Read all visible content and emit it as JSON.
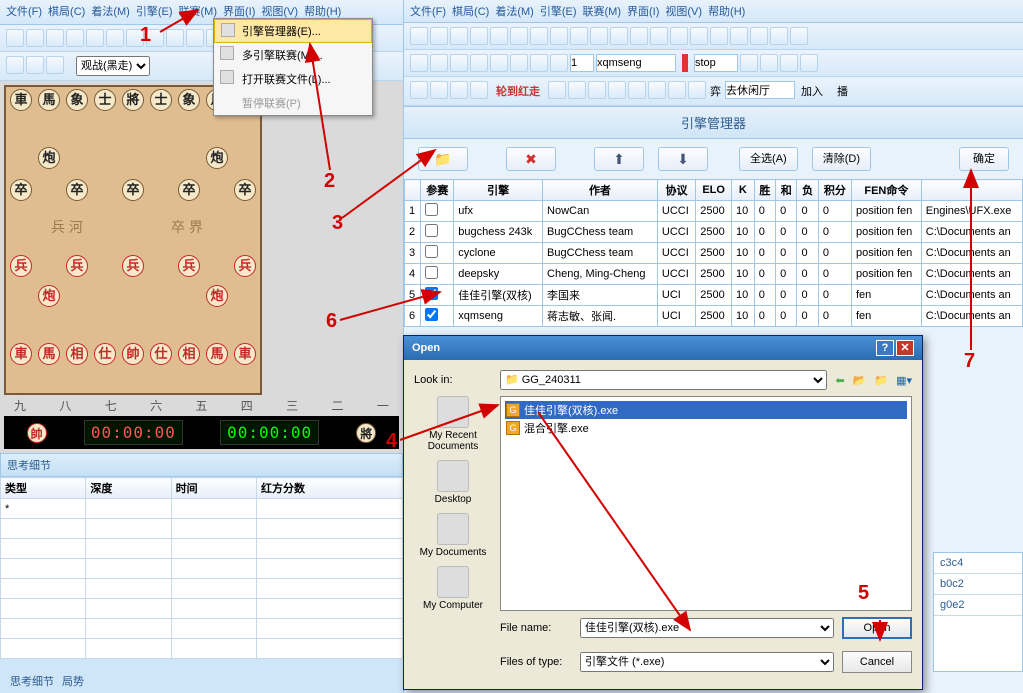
{
  "left": {
    "menus": [
      "文件(F)",
      "棋局(C)",
      "着法(M)",
      "引擎(E)",
      "联赛(M)",
      "界面(I)",
      "视图(V)",
      "帮助(H)"
    ],
    "view_select": "观战(黑走)",
    "thought_title": "思考细节",
    "thought_cols": [
      "类型",
      "深度",
      "时间",
      "红方分数"
    ],
    "thought_first": "*",
    "bottom_tabs": [
      "思考细节",
      "局势"
    ],
    "clock_red": "00:00:00",
    "clock_black": "00:00:00",
    "files_cn": [
      "九",
      "八",
      "七",
      "六",
      "五",
      "四",
      "三",
      "二",
      "一"
    ],
    "river": [
      "兵 河",
      "卒 界"
    ]
  },
  "dropdown": {
    "items": [
      {
        "label": "引擎管理器(E)...",
        "hover": true
      },
      {
        "label": "多引擎联赛(M)..."
      },
      {
        "label": "打开联赛文件(L)..."
      },
      {
        "label": "暂停联赛(P)",
        "disabled": true
      }
    ]
  },
  "right": {
    "menus": [
      "文件(F)",
      "棋局(C)",
      "着法(M)",
      "引擎(E)",
      "联赛(M)",
      "界面(I)",
      "视图(V)",
      "帮助(H)"
    ],
    "spin": "1",
    "engine_text": "xqmseng",
    "status": "stop",
    "turn_text": "轮到红走",
    "room_text": "去休闲厅",
    "join": "加入",
    "broadcast": "播",
    "em_title": "引擎管理器",
    "em_btns_icons": [
      "📁",
      "✖",
      "⬆",
      "⬇"
    ],
    "em_selectall": "全选(A)",
    "em_clear": "清除(D)",
    "em_ok": "确定",
    "em_cols": [
      "",
      "参赛",
      "引擎",
      "作者",
      "协议",
      "ELO",
      "K",
      "胜",
      "和",
      "负",
      "积分",
      "FEN命令",
      ""
    ],
    "em_rows": [
      {
        "n": "1",
        "ch": false,
        "eng": "ufx",
        "auth": "NowCan",
        "proto": "UCCI",
        "elo": "2500",
        "k": "10",
        "w": "0",
        "d": "0",
        "l": "0",
        "p": "0",
        "fen": "position fen",
        "path": "Engines\\UFX.exe"
      },
      {
        "n": "2",
        "ch": false,
        "eng": "bugchess 243k",
        "auth": "BugCChess team",
        "proto": "UCCI",
        "elo": "2500",
        "k": "10",
        "w": "0",
        "d": "0",
        "l": "0",
        "p": "0",
        "fen": "position fen",
        "path": "C:\\Documents an"
      },
      {
        "n": "3",
        "ch": false,
        "eng": "cyclone",
        "auth": "BugCChess team",
        "proto": "UCCI",
        "elo": "2500",
        "k": "10",
        "w": "0",
        "d": "0",
        "l": "0",
        "p": "0",
        "fen": "position fen",
        "path": "C:\\Documents an"
      },
      {
        "n": "4",
        "ch": false,
        "eng": "deepsky",
        "auth": "Cheng, Ming-Cheng",
        "proto": "UCCI",
        "elo": "2500",
        "k": "10",
        "w": "0",
        "d": "0",
        "l": "0",
        "p": "0",
        "fen": "position fen",
        "path": "C:\\Documents an"
      },
      {
        "n": "5",
        "ch": true,
        "eng": "佳佳引擎(双核)",
        "auth": "李国来",
        "proto": "UCI",
        "elo": "2500",
        "k": "10",
        "w": "0",
        "d": "0",
        "l": "0",
        "p": "0",
        "fen": "fen",
        "path": "C:\\Documents an"
      },
      {
        "n": "6",
        "ch": true,
        "eng": "xqmseng",
        "auth": "蒋志敏、张闻.",
        "proto": "UCI",
        "elo": "2500",
        "k": "10",
        "w": "0",
        "d": "0",
        "l": "0",
        "p": "0",
        "fen": "fen",
        "path": "C:\\Documents an"
      }
    ],
    "stub_moves": [
      "c3c4",
      "b0c2",
      "g0e2"
    ]
  },
  "open": {
    "title": "Open",
    "lookin_label": "Look in:",
    "lookin_value": "GG_240311",
    "places": [
      "My Recent Documents",
      "Desktop",
      "My Documents",
      "My Computer"
    ],
    "files": [
      {
        "name": "佳佳引擎(双核).exe",
        "selected": true
      },
      {
        "name": "混合引擎.exe",
        "selected": false
      }
    ],
    "filename_label": "File name:",
    "filename_value": "佳佳引擎(双核).exe",
    "filetype_label": "Files of type:",
    "filetype_value": "引擎文件 (*.exe)",
    "open_btn": "Open",
    "cancel_btn": "Cancel"
  },
  "annotations": {
    "n1": "1",
    "n2": "2",
    "n3": "3",
    "n4": "4",
    "n5": "5",
    "n6": "6",
    "n7": "7"
  }
}
